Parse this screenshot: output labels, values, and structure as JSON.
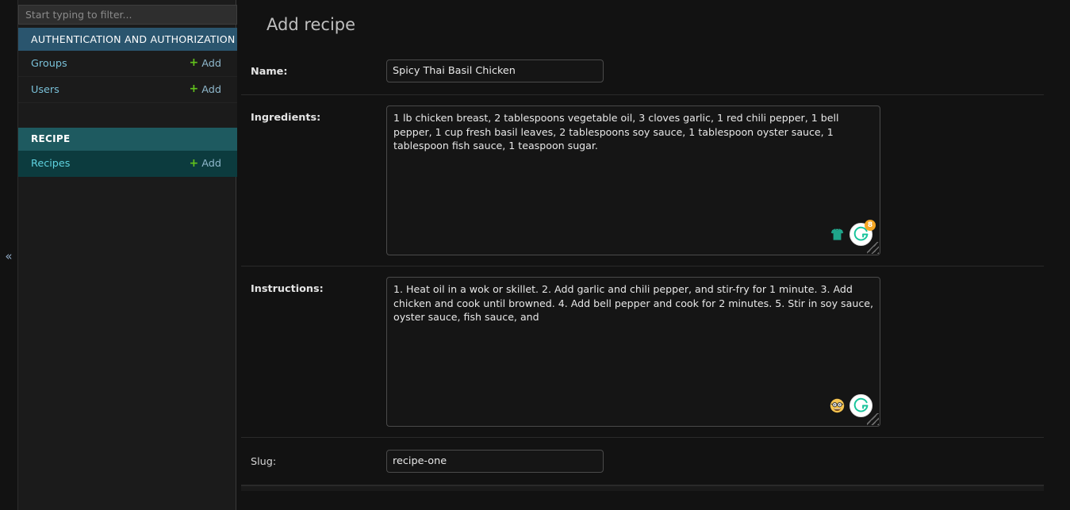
{
  "sidebar": {
    "filter": {
      "value": "",
      "placeholder": "Start typing to filter..."
    },
    "collapse_icon": "«",
    "groups": [
      {
        "header": "AUTHENTICATION AND AUTHORIZATION",
        "header_style": "auth",
        "models": [
          {
            "label": "Groups",
            "add_label": "Add",
            "add_icon": "+",
            "active": false
          },
          {
            "label": "Users",
            "add_label": "Add",
            "add_icon": "+",
            "active": false
          }
        ]
      },
      {
        "header": "RECIPE",
        "header_style": "recipe",
        "models": [
          {
            "label": "Recipes",
            "add_label": "Add",
            "add_icon": "+",
            "active": true
          }
        ]
      }
    ]
  },
  "main": {
    "title": "Add recipe",
    "fields": [
      {
        "label": "Name:",
        "type": "text",
        "value": "Spicy Thai Basil Chicken",
        "bold": true
      },
      {
        "label": "Ingredients:",
        "type": "textarea",
        "value": "1 lb chicken breast, 2 tablespoons vegetable oil, 3 cloves garlic, 1 red chili pepper, 1 bell pepper, 1 cup fresh basil leaves, 2 tablespoons soy sauce, 1 tablespoon oyster sauce, 1 tablespoon fish sauce, 1 teaspoon sugar.",
        "bold": true,
        "assist": {
          "emoji": "tshirt",
          "grammarly_label": "G",
          "badge": "8"
        }
      },
      {
        "label": "Instructions:",
        "type": "textarea",
        "value": "1. Heat oil in a wok or skillet. 2. Add garlic and chili pepper, and stir-fry for 1 minute. 3. Add chicken and cook until browned. 4. Add bell pepper and cook for 2 minutes. 5. Stir in soy sauce, oyster sauce, fish sauce, and",
        "bold": true,
        "assist": {
          "emoji": "nerd-face",
          "grammarly_label": "G",
          "badge": ""
        }
      },
      {
        "label": "Slug:",
        "type": "text",
        "value": "recipe-one",
        "bold": false
      }
    ]
  },
  "colors": {
    "page_bg": "#121212",
    "sidebar_bg": "#1b1b1b",
    "auth_header_bg": "#2a556e",
    "recipe_header_bg": "#1e5a60",
    "active_row_bg": "#0c3b3e",
    "link_blue": "#79c0d8",
    "plus_green": "#62c21c",
    "grammarly_green": "#15c39a",
    "badge_orange": "#f5a623"
  }
}
